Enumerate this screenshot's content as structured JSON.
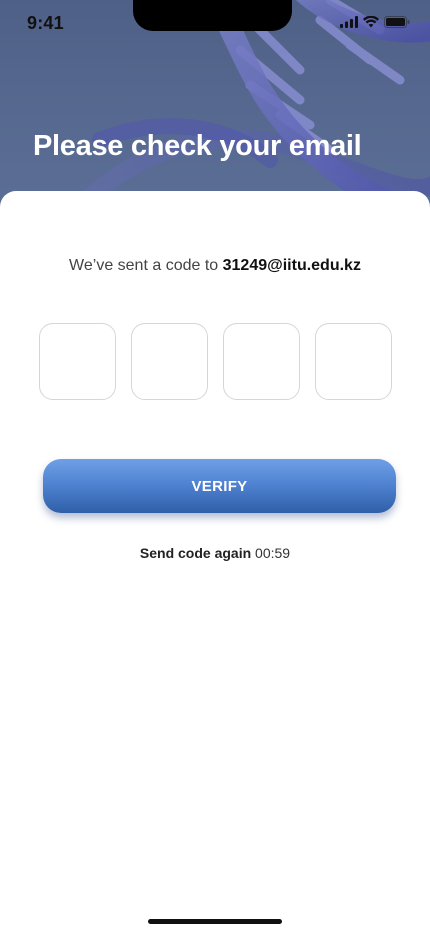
{
  "status_bar": {
    "time": "9:41",
    "icons": [
      "signal-icon",
      "wifi-icon",
      "battery-icon"
    ]
  },
  "header": {
    "title": "Please check your email",
    "background_image": "dna-helix-illustration"
  },
  "verification": {
    "sent_prefix": "We’ve sent a code to",
    "email": "31249@iitu.edu.kz",
    "code_digits": [
      "",
      "",
      "",
      ""
    ],
    "verify_label": "VERIFY",
    "resend_label": "Send code again",
    "countdown": "00:59"
  },
  "colors": {
    "header_bg": "#55678e",
    "button_top": "#6fa0e6",
    "button_bottom": "#2f5fa7",
    "box_border": "#d6d6d6"
  }
}
